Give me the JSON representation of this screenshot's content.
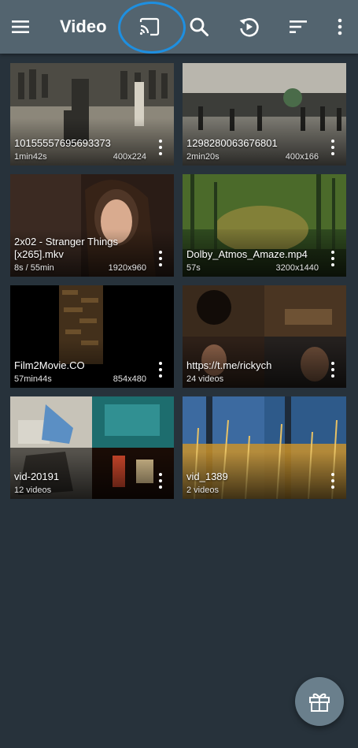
{
  "appbar": {
    "title": "Video",
    "menu_icon": "hamburger-menu-icon",
    "cast_icon": "cast-icon",
    "search_icon": "search-icon",
    "history_icon": "play-history-icon",
    "sort_icon": "sort-icon",
    "overflow_icon": "more-vertical-icon"
  },
  "items": [
    {
      "name": "10155557695693373",
      "left": "1min42s",
      "right": "400x224",
      "kind": "video"
    },
    {
      "name": "1298280063676801",
      "left": "2min20s",
      "right": "400x166",
      "kind": "video"
    },
    {
      "name": "2x02 - Stranger Things [x265].mkv",
      "left": "8s / 55min",
      "right": "1920x960",
      "kind": "video"
    },
    {
      "name": "Dolby_Atmos_Amaze.mp4",
      "left": "57s",
      "right": "3200x1440",
      "kind": "video"
    },
    {
      "name": "Film2Movie.CO",
      "left": "57min44s",
      "right": "854x480",
      "kind": "video"
    },
    {
      "name": "https://t.me/rickych",
      "left": "24 videos",
      "right": "",
      "kind": "folder"
    },
    {
      "name": "vid-20191",
      "left": "12 videos",
      "right": "",
      "kind": "folder"
    },
    {
      "name": "vid_1389",
      "left": "2 videos",
      "right": "",
      "kind": "folder"
    }
  ],
  "fab": {
    "icon": "gift-icon"
  },
  "colors": {
    "appbar": "#53646f",
    "background": "#27323b",
    "cast_highlight": "#1e8fe0"
  }
}
